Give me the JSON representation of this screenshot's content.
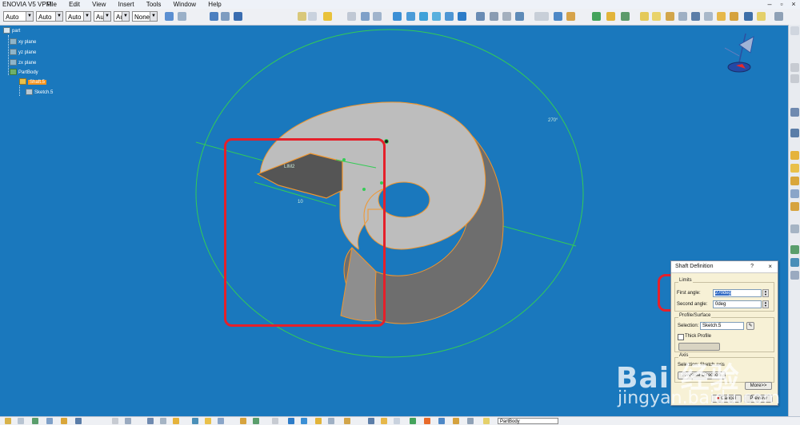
{
  "window": {
    "app_title": "ENOVIA V5 VPM",
    "menu": [
      "File",
      "Edit",
      "View",
      "Insert",
      "Tools",
      "Window",
      "Help"
    ]
  },
  "toolbar": {
    "combos": [
      "Auto",
      "Auto",
      "Auto",
      "Aut",
      "Aut",
      "None"
    ]
  },
  "tree": {
    "root": "part",
    "planes": [
      "xy plane",
      "yz plane",
      "zx plane"
    ],
    "body": "PartBody",
    "feature": "Shaft.5",
    "sketch": "Sketch.5"
  },
  "canvas": {
    "angle_label": "270°",
    "sketch_dim_label": "10",
    "small_label": "LIM2"
  },
  "dialog": {
    "title": "Shaft Definition",
    "help": "?",
    "close": "×",
    "limits_label": "Limits",
    "first_angle_label": "First angle:",
    "first_angle_value": "270deg",
    "second_angle_label": "Second angle:",
    "second_angle_value": "0deg",
    "profile_label": "Profile/Surface",
    "selection_label": "Selection:",
    "selection_value": "Sketch.5",
    "thick_profile_label": "Thick Profile",
    "axis_label": "Axis",
    "axis_selection_value": "Selection: Sketch.axis",
    "reverse_direction_label": "Reverse Direction",
    "more_button": "More>>",
    "cancel_button": "Cancel",
    "preview_button": "Preview"
  },
  "bottom": {
    "body_combo": "PartBody"
  },
  "watermark": {
    "line1": "Bai 经验",
    "line2": "jingyan.baidu.com"
  },
  "colors": {
    "background": "#1a78bd",
    "highlight": "#e5202a",
    "selection": "#f7941d"
  }
}
